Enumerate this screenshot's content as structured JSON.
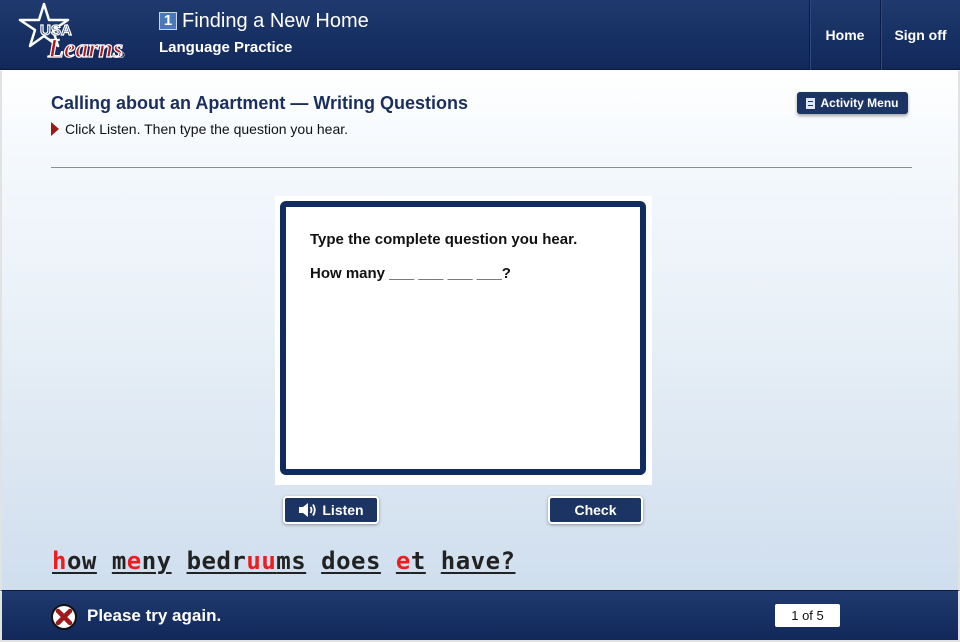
{
  "header": {
    "logo": {
      "line1": "USA",
      "line2": "Learns",
      "mark": "®"
    },
    "unit_number": "1",
    "unit_title": "Finding a New Home",
    "subtitle": "Language Practice",
    "nav": [
      {
        "label": "Home"
      },
      {
        "label": "Sign off"
      }
    ]
  },
  "activity": {
    "title": "Calling about an Apartment — Writing Questions",
    "instruction": "Click Listen. Then type the question you hear.",
    "menu_button": "Activity Menu",
    "menu_icon": "menu-book-icon"
  },
  "card": {
    "prompt": "Type the complete question you hear.",
    "question": "How many ___ ___ ___ ___?"
  },
  "buttons": {
    "listen": "Listen",
    "listen_icon": "speaker-icon",
    "check": "Check"
  },
  "answer": {
    "words": [
      {
        "segments": [
          {
            "text": "h",
            "error": true
          },
          {
            "text": "ow",
            "error": false
          }
        ]
      },
      {
        "segments": [
          {
            "text": "m",
            "error": false
          },
          {
            "text": "e",
            "error": true
          },
          {
            "text": "ny",
            "error": false
          }
        ]
      },
      {
        "segments": [
          {
            "text": "bedr",
            "error": false
          },
          {
            "text": "uu",
            "error": true
          },
          {
            "text": "ms",
            "error": false
          }
        ]
      },
      {
        "segments": [
          {
            "text": "does",
            "error": false
          }
        ]
      },
      {
        "segments": [
          {
            "text": "e",
            "error": true
          },
          {
            "text": "t",
            "error": false
          }
        ]
      },
      {
        "segments": [
          {
            "text": "have?",
            "error": false
          }
        ]
      }
    ],
    "error_color": "#ee1c1c"
  },
  "footer": {
    "status_icon": "x-circle-icon",
    "status_text": "Please try again.",
    "page_indicator": "1 of 5"
  },
  "colors": {
    "brand_navy": "#1b3464",
    "header_navy": "#173063",
    "accent_red": "#9b1b1b"
  }
}
